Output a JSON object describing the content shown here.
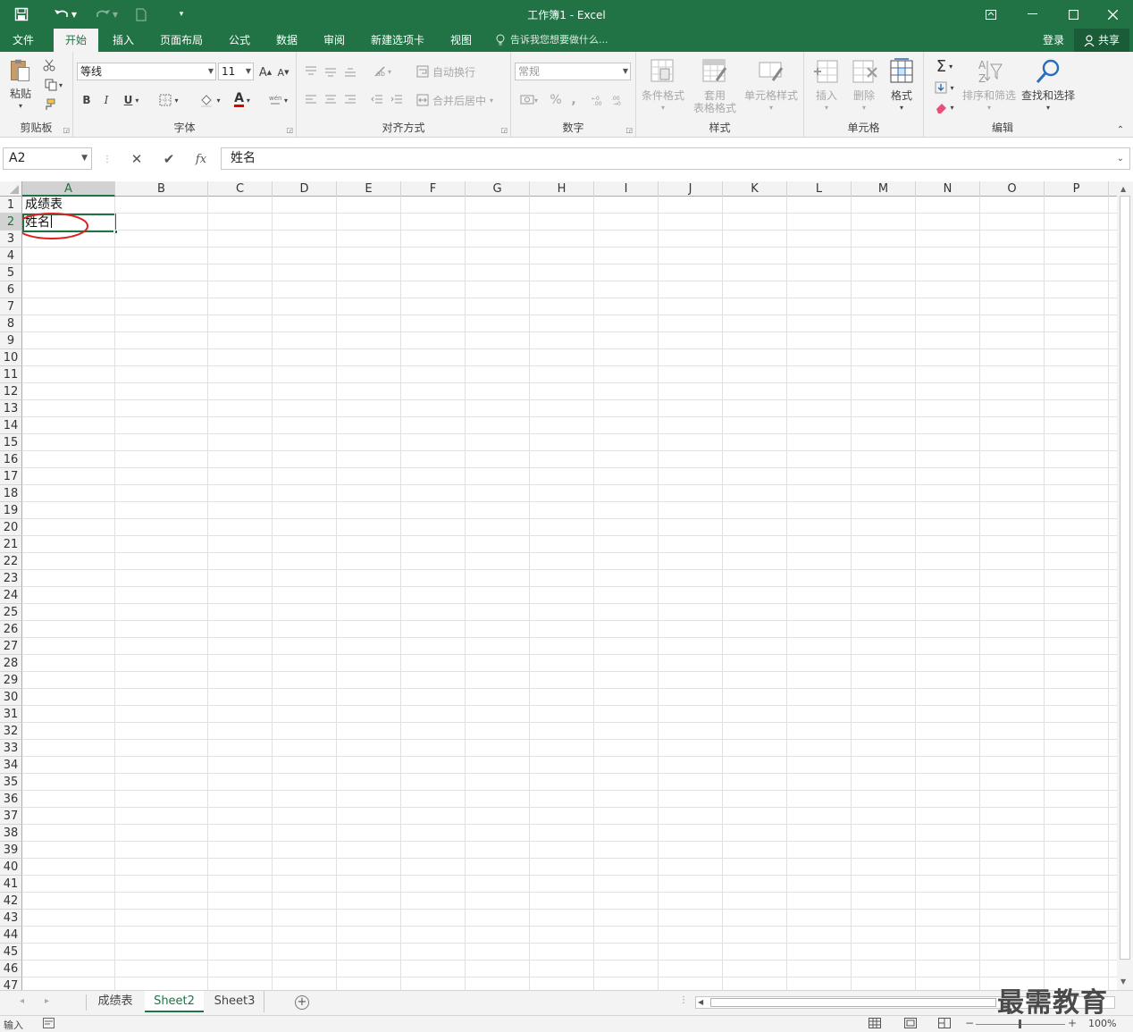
{
  "titlebar": {
    "title": "工作簿1 - Excel",
    "save_icon": "save-icon",
    "undo_icon": "undo-icon",
    "redo_icon": "redo-icon",
    "new_icon": "new-document-icon",
    "customize_icon": "customize-qat-icon"
  },
  "tabs": {
    "file": "文件",
    "home": "开始",
    "insert": "插入",
    "layout": "页面布局",
    "formulas": "公式",
    "data": "数据",
    "review": "审阅",
    "newtab": "新建选项卡",
    "view": "视图",
    "tellme": "告诉我您想要做什么...",
    "login": "登录",
    "share": "共享"
  },
  "ribbon": {
    "clipboard": {
      "label": "剪贴板",
      "paste": "粘贴"
    },
    "font": {
      "label": "字体",
      "name": "等线",
      "size": "11",
      "bold": "B",
      "italic": "I",
      "underline": "U",
      "grow": "A",
      "shrink": "A",
      "fontcolor": "A",
      "fontcolor_hex": "#e00000"
    },
    "alignment": {
      "label": "对齐方式",
      "wrap": "自动换行",
      "merge": "合并后居中"
    },
    "number": {
      "label": "数字",
      "format": "常规",
      "percent": "%",
      "comma": ","
    },
    "styles": {
      "label": "样式",
      "conditional": "条件格式",
      "table_line1": "套用",
      "table_line2": "表格格式",
      "cellstyle": "单元格样式"
    },
    "cells": {
      "label": "单元格",
      "insert": "插入",
      "delete": "删除",
      "format": "格式"
    },
    "editing": {
      "label": "编辑",
      "sigma": "Σ",
      "sort": "排序和筛选",
      "find": "查找和选择"
    }
  },
  "formula_bar": {
    "namebox": "A2",
    "cancel": "✕",
    "enter": "✔",
    "fx": "fx",
    "content": "姓名"
  },
  "columns": [
    "A",
    "B",
    "C",
    "D",
    "E",
    "F",
    "G",
    "H",
    "I",
    "J",
    "K",
    "L",
    "M",
    "N",
    "O",
    "P"
  ],
  "rows": [
    "1",
    "2",
    "3",
    "4",
    "5",
    "6",
    "7",
    "8",
    "9",
    "10",
    "11",
    "12",
    "13",
    "14",
    "15",
    "16",
    "17",
    "18",
    "19",
    "20",
    "21",
    "22",
    "23",
    "24",
    "25",
    "26",
    "27",
    "28",
    "29",
    "30",
    "31",
    "32",
    "33",
    "34",
    "35",
    "36",
    "37",
    "38",
    "39",
    "40",
    "41",
    "42",
    "43",
    "44",
    "45",
    "46",
    "47"
  ],
  "cells": {
    "a1": "成绩表",
    "a2": "姓名"
  },
  "sheets": {
    "s1": "成绩表",
    "s2": "Sheet2",
    "s3": "Sheet3",
    "add": "+"
  },
  "status": {
    "mode": "输入",
    "zoom": "100%"
  },
  "watermark": "最需教育",
  "colors": {
    "accent": "#217346",
    "annotation": "#e02020"
  }
}
